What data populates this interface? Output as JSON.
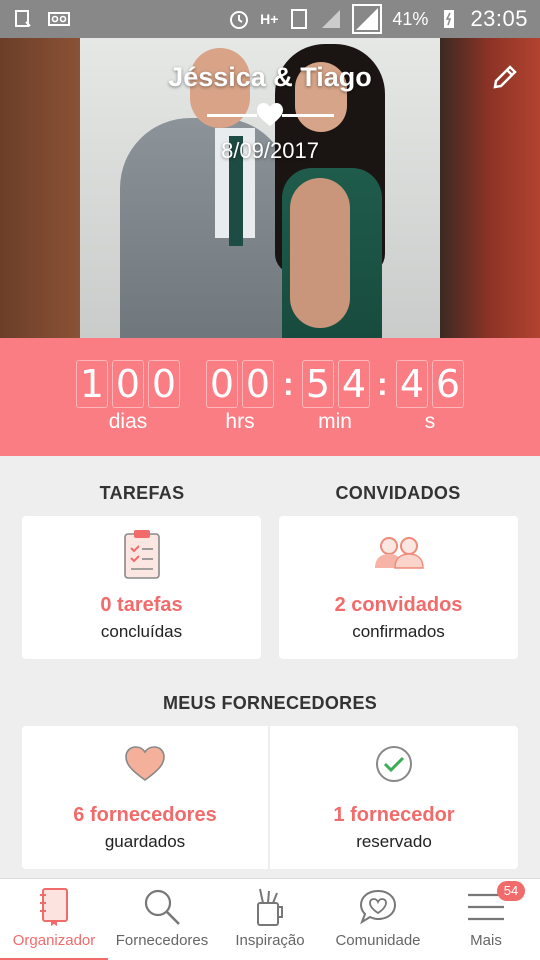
{
  "status_bar": {
    "battery": "41%",
    "time": "23:05",
    "network": "H+"
  },
  "hero": {
    "couple_names": "Jéssica & Tiago",
    "date": "8/09/2017"
  },
  "countdown": {
    "days": [
      "1",
      "0",
      "0"
    ],
    "hours": [
      "0",
      "0"
    ],
    "minutes": [
      "5",
      "4"
    ],
    "seconds": [
      "4",
      "6"
    ],
    "labels": {
      "days": "dias",
      "hours": "hrs",
      "minutes": "min",
      "seconds": "s"
    }
  },
  "tasks": {
    "title": "TAREFAS",
    "count_label": "0 tarefas",
    "sub": "concluídas"
  },
  "guests": {
    "title": "CONVIDADOS",
    "count_label": "2 convidados",
    "sub": "confirmados"
  },
  "vendors": {
    "title": "MEUS FORNECEDORES",
    "saved_label": "6 fornecedores",
    "saved_sub": "guardados",
    "booked_label": "1 fornecedor",
    "booked_sub": "reservado"
  },
  "nav": {
    "items": [
      {
        "label": "Organizador",
        "icon": "notebook-icon",
        "active": true
      },
      {
        "label": "Fornecedores",
        "icon": "search-icon"
      },
      {
        "label": "Inspiração",
        "icon": "tools-cup-icon"
      },
      {
        "label": "Comunidade",
        "icon": "heart-chat-icon"
      },
      {
        "label": "Mais",
        "icon": "menu-icon"
      }
    ],
    "badge": "54"
  },
  "colors": {
    "accent": "#f26b6b",
    "countdown_bg": "#fb7d84"
  }
}
